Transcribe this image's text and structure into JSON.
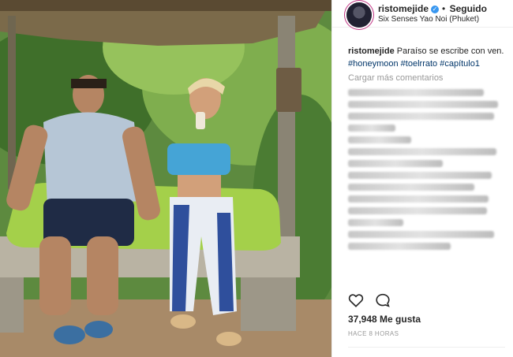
{
  "post": {
    "username": "ristomejide",
    "follow_status": "Seguido",
    "location": "Six Senses Yao Noi (Phuket)",
    "caption": {
      "username": "ristomejide",
      "text": " Paraíso se escribe con ven.",
      "hashtags": [
        "#honeymoon",
        "#toelrrato",
        "#capítulo1"
      ]
    },
    "load_more": "Cargar más comentarios",
    "likes": "37,948 Me gusta",
    "time": "HACE 8 HORAS"
  },
  "icons": {
    "like": "heart-icon",
    "comment": "comment-icon",
    "verified": "verified-badge-icon"
  },
  "colors": {
    "hashtag": "#003569",
    "verified": "#3897f0",
    "muted": "#999999"
  }
}
